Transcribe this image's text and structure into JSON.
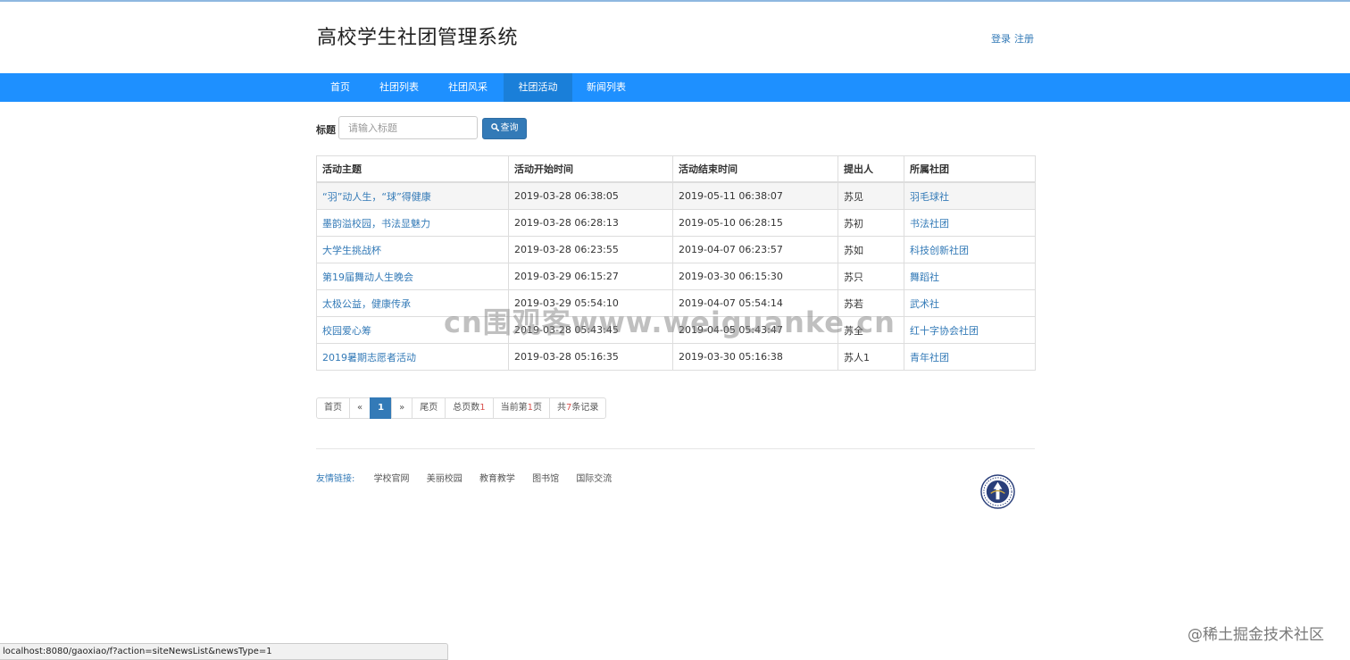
{
  "header": {
    "site_title": "高校学生社团管理系统",
    "login": "登录",
    "register": "注册"
  },
  "nav": {
    "items": [
      {
        "label": "首页"
      },
      {
        "label": "社团列表"
      },
      {
        "label": "社团风采"
      },
      {
        "label": "社团活动",
        "active": true
      },
      {
        "label": "新闻列表"
      }
    ]
  },
  "search": {
    "label": "标题",
    "placeholder": "请输入标题",
    "value": "",
    "button_label": "查询"
  },
  "table": {
    "columns": [
      "活动主题",
      "活动开始时间",
      "活动结束时间",
      "提出人",
      "所属社团"
    ],
    "rows": [
      {
        "topic": "“羽”动人生，“球”得健康",
        "start": "2019-03-28 06:38:05",
        "end": "2019-05-11 06:38:07",
        "proposer": "苏见",
        "club": "羽毛球社"
      },
      {
        "topic": "墨韵溢校园，书法显魅力",
        "start": "2019-03-28 06:28:13",
        "end": "2019-05-10 06:28:15",
        "proposer": "苏初",
        "club": "书法社团"
      },
      {
        "topic": "大学生挑战杯",
        "start": "2019-03-28 06:23:55",
        "end": "2019-04-07 06:23:57",
        "proposer": "苏如",
        "club": "科技创新社团"
      },
      {
        "topic": "第19届舞动人生晚会",
        "start": "2019-03-29 06:15:27",
        "end": "2019-03-30 06:15:30",
        "proposer": "苏只",
        "club": "舞蹈社"
      },
      {
        "topic": "太极公益，健康传承",
        "start": "2019-03-29 05:54:10",
        "end": "2019-04-07 05:54:14",
        "proposer": "苏若",
        "club": "武术社"
      },
      {
        "topic": "校园爱心筹",
        "start": "2019-03-28 05:43:45",
        "end": "2019-04-05 05:43:47",
        "proposer": "苏全",
        "club": "红十字协会社团"
      },
      {
        "topic": "2019暑期志愿者活动",
        "start": "2019-03-28 05:16:35",
        "end": "2019-03-30 05:16:38",
        "proposer": "苏人1",
        "club": "青年社团"
      }
    ]
  },
  "pager": {
    "first": "首页",
    "prev": "«",
    "current": "1",
    "next": "»",
    "last": "尾页",
    "total_pages_prefix": "总页数",
    "total_pages": "1",
    "current_page_prefix": "当前第",
    "current_page": "1",
    "current_page_suffix": "页",
    "total_records_prefix": "共",
    "total_records": "7",
    "total_records_suffix": "条记录"
  },
  "footer": {
    "links_label": "友情链接:",
    "links": [
      "学校官网",
      "美丽校园",
      "教育教学",
      "图书馆",
      "国际交流"
    ]
  },
  "statusbar": {
    "url": "localhost:8080/gaoxiao/f?action=siteNewsList&newsType=1"
  },
  "overlays": {
    "watermark": "cn围观客www.weiguanke.cn",
    "corner_mark": "@稀土掘金技术社区"
  },
  "colors": {
    "nav_bg": "#1e90ff",
    "nav_active": "#1a7fd9",
    "link": "#337ab7",
    "button": "#337ab7"
  },
  "icons": {
    "search_button_icon": "magnifier",
    "footer_logo": "school-emblem"
  }
}
